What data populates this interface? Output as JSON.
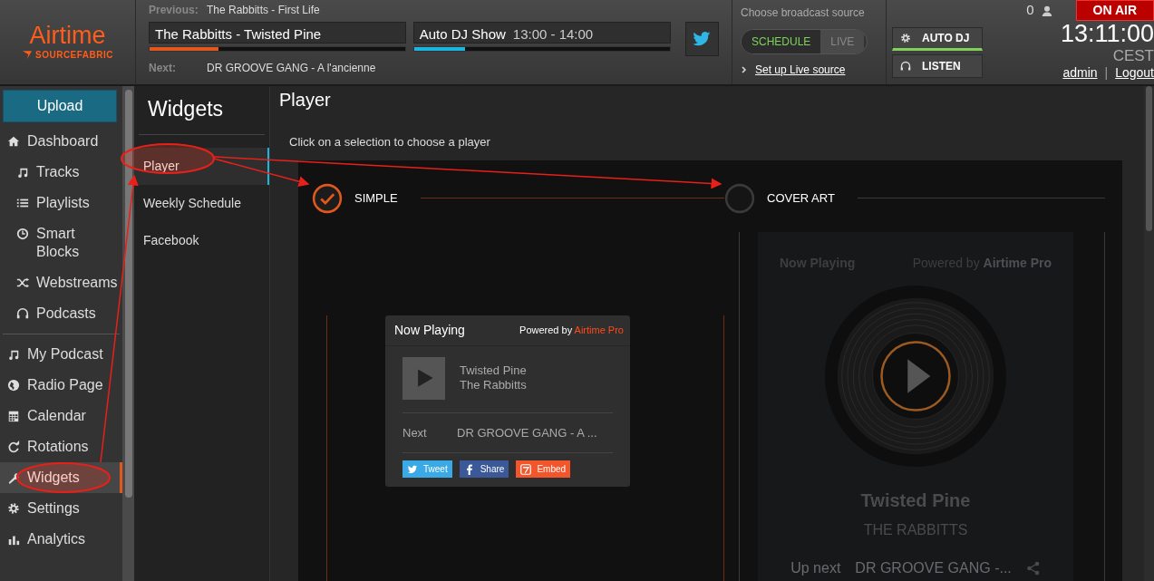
{
  "header": {
    "logo": {
      "name": "Airtime",
      "sub": "SOURCEFABRIC"
    },
    "previous": {
      "label": "Previous:",
      "value": "The Rabbitts - First Life"
    },
    "current_track": {
      "title": "The Rabbitts - Twisted Pine",
      "level": 0.27
    },
    "current_show": {
      "title": "Auto DJ Show",
      "time": "13:00 - 14:00",
      "level": 0.2
    },
    "next": {
      "label": "Next:",
      "value": "DR GROOVE GANG - A l'ancienne"
    },
    "broadcast": {
      "title": "Choose broadcast source",
      "sources": [
        {
          "label": "SCHEDULE",
          "selected": true
        },
        {
          "label": "LIVE",
          "selected": false
        }
      ],
      "link": "Set up Live source"
    },
    "modes": [
      {
        "label": "AUTO DJ",
        "kind": "gear",
        "on": true
      },
      {
        "label": "LISTEN",
        "kind": "headphones",
        "on": false
      }
    ],
    "listeners": "0",
    "on_air": "ON AIR",
    "clock": "13:11:00",
    "timezone": "CEST",
    "user": "admin",
    "separator": "|",
    "logout": "Logout"
  },
  "sidebar": {
    "upload": "Upload",
    "groups": [
      [
        {
          "label": "Dashboard",
          "kind": "home",
          "selected": false,
          "children": [
            {
              "label": "Tracks",
              "kind": "music",
              "selected": false
            },
            {
              "label": "Playlists",
              "kind": "list",
              "selected": false
            },
            {
              "label": "Smart Blocks",
              "kind": "clock",
              "selected": false
            },
            {
              "label": "Webstreams",
              "kind": "shuffle",
              "selected": false
            },
            {
              "label": "Podcasts",
              "kind": "headphones",
              "selected": false
            }
          ]
        }
      ],
      [
        {
          "label": "My Podcast",
          "kind": "music",
          "selected": false
        },
        {
          "label": "Radio Page",
          "kind": "globe",
          "selected": false
        },
        {
          "label": "Calendar",
          "kind": "calendar",
          "selected": false
        },
        {
          "label": "Rotations",
          "kind": "refresh",
          "selected": false
        },
        {
          "label": "Widgets",
          "kind": "wrench",
          "selected": true
        },
        {
          "label": "Settings",
          "kind": "gear",
          "selected": false
        },
        {
          "label": "Analytics",
          "kind": "chart",
          "selected": false
        }
      ]
    ]
  },
  "subnav": {
    "title": "Widgets",
    "items": [
      {
        "label": "Player",
        "selected": true
      },
      {
        "label": "Weekly Schedule",
        "selected": false
      },
      {
        "label": "Facebook",
        "selected": false
      }
    ]
  },
  "main": {
    "title": "Player",
    "hint": "Click on a selection to choose a player",
    "options": [
      {
        "kind": "simple",
        "label": "SIMPLE",
        "selected": true,
        "widget": {
          "heading": "Now Playing",
          "powered": "Powered by",
          "brand": "Airtime Pro",
          "track": "Twisted Pine",
          "artist": "The Rabbitts",
          "next_label": "Next",
          "next": "DR GROOVE GANG - A ...",
          "share": [
            {
              "kind": "twitter",
              "label": "Tweet"
            },
            {
              "kind": "facebook",
              "label": "Share"
            },
            {
              "kind": "embed",
              "label": "Embed"
            }
          ]
        }
      },
      {
        "kind": "cover",
        "label": "COVER ART",
        "selected": false,
        "widget": {
          "heading": "Now Playing",
          "powered": "Powered by",
          "brand": "Airtime Pro",
          "track": "Twisted Pine",
          "artist": "THE RABBITTS",
          "next_label": "Up next",
          "next": "DR GROOVE GANG -..."
        }
      }
    ]
  }
}
